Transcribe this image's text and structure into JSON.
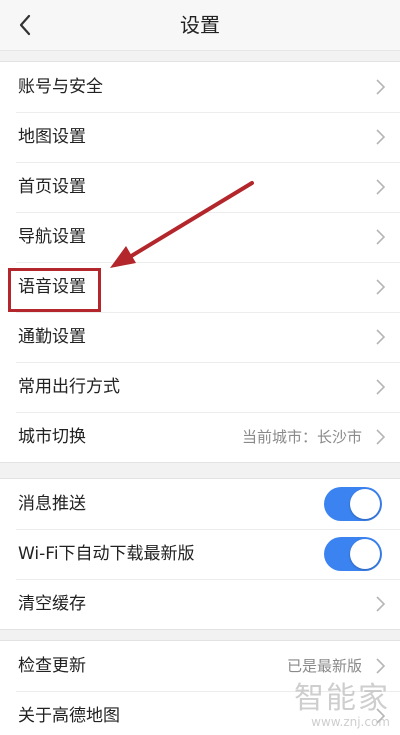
{
  "header": {
    "title": "设置"
  },
  "groups": {
    "main": [
      {
        "label": "账号与安全"
      },
      {
        "label": "地图设置"
      },
      {
        "label": "首页设置"
      },
      {
        "label": "导航设置"
      },
      {
        "label": "语音设置"
      },
      {
        "label": "通勤设置"
      },
      {
        "label": "常用出行方式"
      },
      {
        "label": "城市切换",
        "value": "当前城市：长沙市"
      }
    ],
    "toggles": [
      {
        "label": "消息推送",
        "on": true
      },
      {
        "label": "Wi-Fi下自动下载最新版",
        "on": true
      },
      {
        "label": "清空缓存"
      }
    ],
    "about": [
      {
        "label": "检查更新",
        "value": "已是最新版"
      },
      {
        "label": "关于高德地图"
      }
    ]
  },
  "watermark": {
    "main": "智能家",
    "sub": "www.znj.com"
  },
  "colors": {
    "toggle_on": "#3b83f0",
    "annotation": "#b3262b"
  },
  "icons": {
    "back": "chevron-left-icon",
    "row_arrow": "chevron-right-icon"
  }
}
